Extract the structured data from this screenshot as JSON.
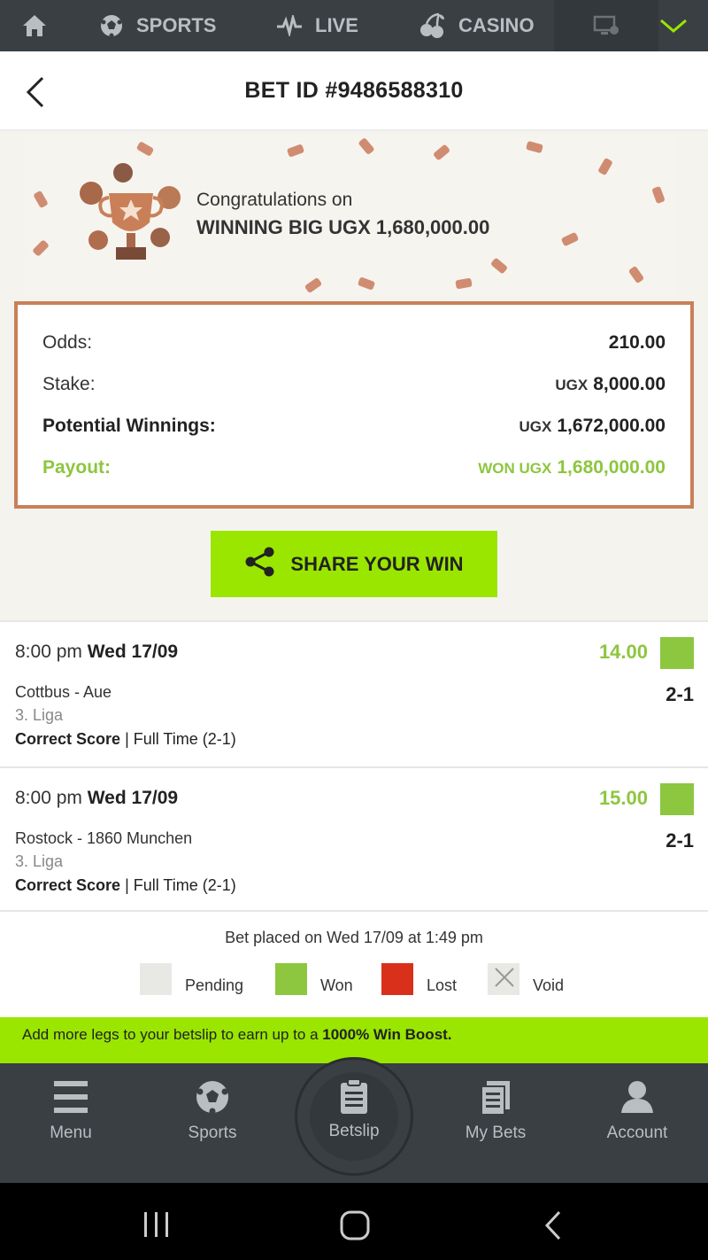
{
  "topnav": {
    "sports_label": "SPORTS",
    "live_label": "LIVE",
    "casino_label": "CASINO",
    "icons": [
      "home-icon",
      "soccer-ball-icon",
      "pulse-icon",
      "cherries-icon",
      "virtual-screen-icon",
      "chevron-down-icon"
    ]
  },
  "header": {
    "title": "BET ID #9486588310"
  },
  "banner": {
    "line1": "Congratulations on",
    "line2": "WINNING BIG UGX 1,680,000.00"
  },
  "summary": {
    "odds_label": "Odds:",
    "odds_value": "210.00",
    "stake_label": "Stake:",
    "stake_currency": "UGX",
    "stake_value": "8,000.00",
    "potential_label": "Potential Winnings:",
    "potential_currency": "UGX",
    "potential_value": "1,672,000.00",
    "payout_label": "Payout:",
    "payout_currency": "WON UGX",
    "payout_value": "1,680,000.00"
  },
  "share": {
    "label": "SHARE YOUR WIN"
  },
  "selections": [
    {
      "time": "8:00 pm",
      "date": "Wed 17/09",
      "odds": "14.00",
      "match": "Cottbus - Aue",
      "score": "2-1",
      "league": "3. Liga",
      "market": "Correct Score",
      "outcome": " | Full Time (2-1)",
      "status": "won"
    },
    {
      "time": "8:00 pm",
      "date": "Wed 17/09",
      "odds": "15.00",
      "match": "Rostock - 1860 Munchen",
      "score": "2-1",
      "league": "3. Liga",
      "market": "Correct Score",
      "outcome": " | Full Time (2-1)",
      "status": "won"
    }
  ],
  "footer": {
    "placed": "Bet placed on Wed 17/09 at 1:49 pm",
    "legend": {
      "pending": "Pending",
      "won": "Won",
      "lost": "Lost",
      "void": "Void"
    },
    "boost_prefix": "Add more legs to your betslip to earn up to a ",
    "boost_bold": "1000% Win Boost."
  },
  "bottomnav": {
    "menu": "Menu",
    "sports": "Sports",
    "betslip": "Betslip",
    "mybets": "My Bets",
    "account": "Account"
  },
  "colors": {
    "won": "#8dc63f",
    "lost": "#d9301c",
    "pending": "#e8e8e4",
    "accent": "#9ae600",
    "nav_bg": "#3a3f44",
    "border": "#c98058"
  }
}
